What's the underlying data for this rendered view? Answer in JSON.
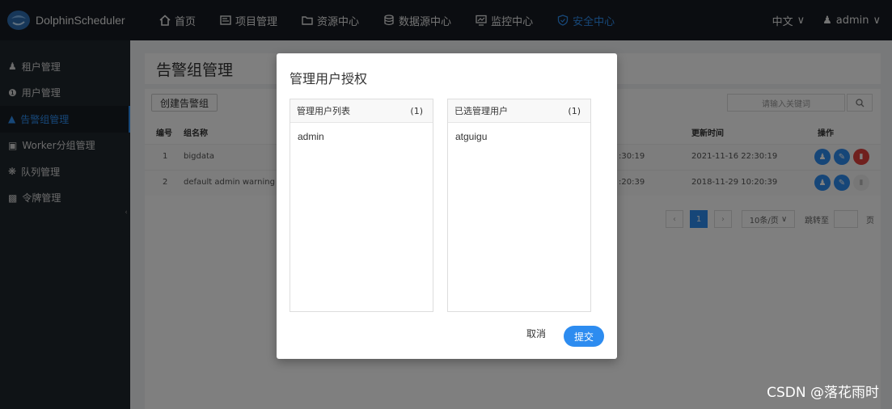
{
  "app": {
    "name": "DolphinScheduler"
  },
  "nav": [
    {
      "label": "首页",
      "icon": "home-icon"
    },
    {
      "label": "项目管理",
      "icon": "project-icon"
    },
    {
      "label": "资源中心",
      "icon": "folder-icon"
    },
    {
      "label": "数据源中心",
      "icon": "database-icon"
    },
    {
      "label": "监控中心",
      "icon": "monitor-icon"
    },
    {
      "label": "安全中心",
      "icon": "shield-icon",
      "active": true
    }
  ],
  "top_right": {
    "language": "中文",
    "user": "admin"
  },
  "sidebar": [
    {
      "label": "租户管理",
      "icon": "user-icon"
    },
    {
      "label": "用户管理",
      "icon": "info-circle-icon"
    },
    {
      "label": "告警组管理",
      "icon": "warning-icon",
      "active": true
    },
    {
      "label": "Worker分组管理",
      "icon": "group-icon"
    },
    {
      "label": "队列管理",
      "icon": "gear-icon"
    },
    {
      "label": "令牌管理",
      "icon": "document-icon"
    }
  ],
  "page": {
    "title": "告警组管理",
    "create_button": "创建告警组",
    "search_placeholder": "请输入关键词",
    "columns": {
      "index": "编号",
      "name": "组名称",
      "updated": "更新时间",
      "ops": "操作"
    },
    "rows": [
      {
        "index": "1",
        "name": "bigdata",
        "created_partial": ":30:19",
        "updated": "2021-11-16 22:30:19"
      },
      {
        "index": "2",
        "name": "default admin warning grou",
        "created_partial": ":20:39",
        "updated": "2018-11-29 10:20:39"
      }
    ],
    "pagination": {
      "current": "1",
      "page_size": "10条/页",
      "jump_label": "跳转至",
      "page_label": "页"
    }
  },
  "modal": {
    "title": "管理用户授权",
    "left_list": {
      "title": "管理用户列表",
      "count": "(1)",
      "items": [
        "admin"
      ]
    },
    "right_list": {
      "title": "已选管理用户",
      "count": "(1)",
      "items": [
        "atguigu"
      ]
    },
    "cancel_label": "取消",
    "submit_label": "提交"
  },
  "watermark": "CSDN @落花雨时",
  "colors": {
    "accent": "#2d8cf0",
    "topbar": "#161b22",
    "sidebar": "#1f262d",
    "danger": "#e0403c"
  }
}
